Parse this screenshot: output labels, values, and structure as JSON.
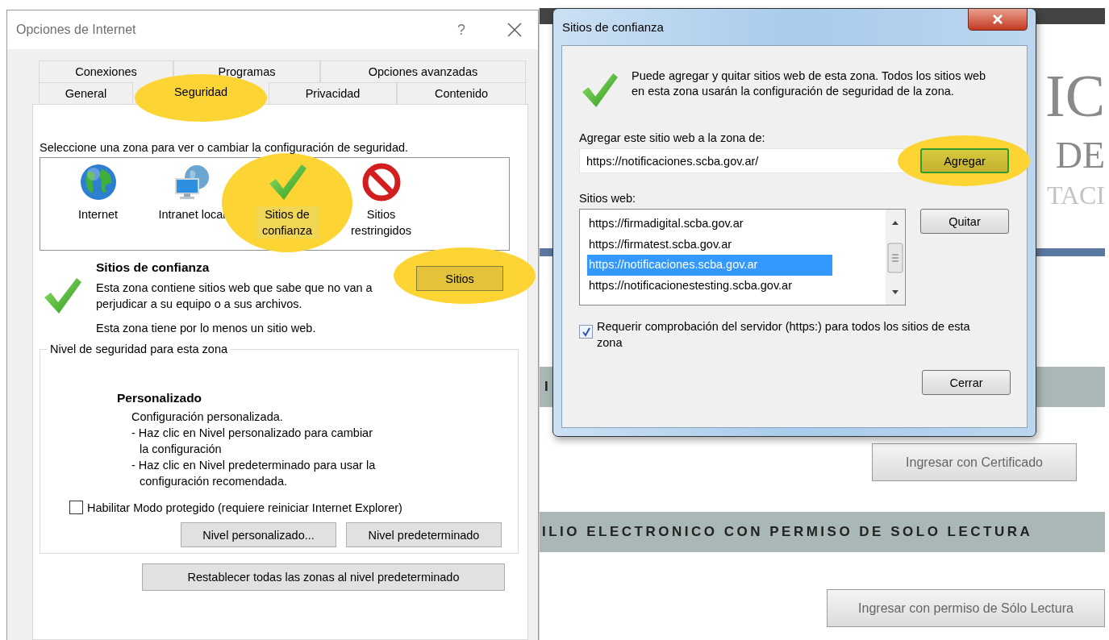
{
  "internet_options": {
    "title": "Opciones de Internet",
    "help": "?",
    "tab_rows": [
      [
        {
          "label": "Conexiones",
          "selected": false,
          "highlighted": false
        },
        {
          "label": "Programas",
          "selected": false,
          "highlighted": false
        },
        {
          "label": "Opciones avanzadas",
          "selected": false,
          "highlighted": false
        }
      ],
      [
        {
          "label": "General",
          "selected": false,
          "highlighted": false
        },
        {
          "label": "Seguridad",
          "selected": true,
          "highlighted": true
        },
        {
          "label": "Privacidad",
          "selected": false,
          "highlighted": false
        },
        {
          "label": "Contenido",
          "selected": false,
          "highlighted": false
        }
      ]
    ],
    "zone_prompt": "Seleccione una zona para ver o cambiar la configuración de seguridad.",
    "zones": [
      {
        "label": "Internet",
        "kind": "globe",
        "selected": false,
        "highlighted": false
      },
      {
        "label": "Intranet local",
        "kind": "intranet",
        "selected": false,
        "highlighted": false
      },
      {
        "label": "Sitios de confianza",
        "kind": "trusted",
        "selected": true,
        "highlighted": true
      },
      {
        "label": "Sitios restringidos",
        "kind": "restricted",
        "selected": false,
        "highlighted": false
      }
    ],
    "zone_title": "Sitios de confianza",
    "zone_description": "Esta zona contiene sitios web que sabe que no van a perjudicar a su equipo o a sus archivos.",
    "zone_note": "Esta zona tiene por lo menos un sitio web.",
    "sites_button": {
      "label": "Sitios",
      "highlighted": true
    },
    "level_group": {
      "legend": "Nivel de seguridad para esta zona",
      "level_name": "Personalizado",
      "lines": [
        "Configuración personalizada.",
        "- Haz clic en Nivel personalizado para cambiar",
        "la configuración",
        "- Haz clic en Nivel predeterminado para usar la",
        "configuración recomendada."
      ],
      "protected_mode": {
        "label": "Habilitar Modo protegido (requiere reiniciar Internet Explorer)",
        "checked": false
      },
      "buttons": [
        "Nivel personalizado...",
        "Nivel predeterminado"
      ]
    },
    "reset_button": "Restablecer todas las zonas al nivel predeterminado"
  },
  "background_page": {
    "heading_fragments": [
      "IC",
      "DE",
      "TACI"
    ],
    "band_1": "I",
    "button_1": "Ingresar con Certificado",
    "band_2": "ILIO ELECTRONICO CON PERMISO DE SOLO LECTURA",
    "button_2": "Ingresar con permiso de Sólo Lectura"
  },
  "trusted_sites": {
    "title": "Sitios de confianza",
    "info": "Puede agregar y quitar sitios web de esta zona. Todos los sitios web en esta zona usarán la configuración de seguridad de la zona.",
    "add_label": "Agregar este sitio web a la zona de:",
    "add_value": "https://notificaciones.scba.gov.ar/",
    "add_button": {
      "label": "Agregar",
      "highlighted": true
    },
    "list_label": "Sitios web:",
    "sites": [
      {
        "url": "https://firmadigital.scba.gov.ar",
        "selected": false
      },
      {
        "url": "https://firmatest.scba.gov.ar",
        "selected": false
      },
      {
        "url": "https://notificaciones.scba.gov.ar",
        "selected": true
      },
      {
        "url": "https://notificacionestesting.scba.gov.ar",
        "selected": false
      }
    ],
    "remove_button": "Quitar",
    "require_https": {
      "label": "Requerir comprobación del servidor (https:) para todos los sitios de esta zona",
      "checked": true
    },
    "close_button": "Cerrar"
  }
}
